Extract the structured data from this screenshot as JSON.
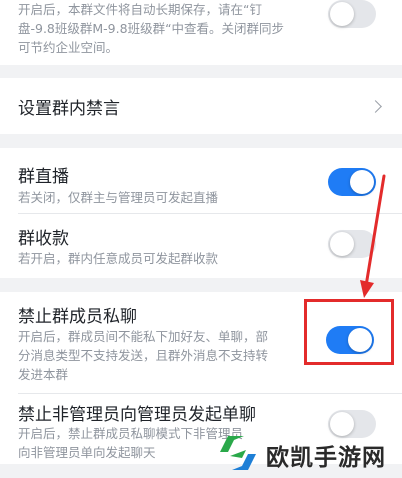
{
  "top_setting": {
    "desc_line1": "开启后，本群文件将自动长期保存，请在“钉",
    "desc_line2": "盘-9.8班级群M-9.8班级群“中查看。关闭群同步",
    "desc_line3": "可节约企业空间。",
    "toggle_on": false
  },
  "mute_setting": {
    "title": "设置群内禁言"
  },
  "live_setting": {
    "title": "群直播",
    "desc": "若关闭，仅群主与管理员可发起直播",
    "toggle_on": true
  },
  "payment_setting": {
    "title": "群收款",
    "desc": "若开启，群内任意成员可发起群收款",
    "toggle_on": false
  },
  "private_chat_setting": {
    "title": "禁止群成员私聊",
    "desc_line1": "开启后，群成员间不能私下加好友、单聊，部",
    "desc_line2": "分消息类型不支持发送，且群外消息不支持转",
    "desc_line3": "发进本群",
    "toggle_on": true
  },
  "non_admin_setting": {
    "title": "禁止非管理员向管理员发起单聊",
    "desc_line1": "开启后，禁止群成员私聊模式下非管理员",
    "desc_line2": "向非管理员单向发起聊天",
    "toggle_on": false
  },
  "annotation": {
    "color": "#e32b2b"
  },
  "watermark": {
    "text": "欧凯手游网"
  }
}
